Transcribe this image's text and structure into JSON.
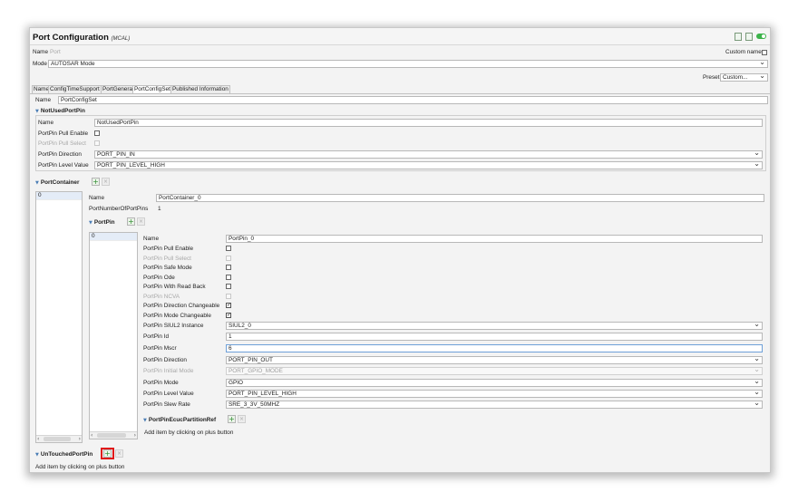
{
  "header": {
    "title": "Port Configuration",
    "subtitle": "(MCAL)",
    "name_label": "Name",
    "name_value": "Port",
    "custom_name_label": "Custom name",
    "mode_label": "Mode",
    "mode_value": "AUTOSAR Mode",
    "preset_label": "Preset",
    "preset_value": "Custom..."
  },
  "tabs": [
    {
      "label": "Name",
      "active": false
    },
    {
      "label": "ConfigTimeSupport",
      "active": false
    },
    {
      "label": "PortGeneral",
      "active": false
    },
    {
      "label": "PortConfigSet",
      "active": true
    },
    {
      "label": "Published Information",
      "active": false
    }
  ],
  "config_set": {
    "name_label": "Name",
    "name_value": "PortConfigSet"
  },
  "not_used_pin": {
    "header": "NotUsedPortPin",
    "name_label": "Name",
    "name_value": "NotUsedPortPin",
    "pull_enable_label": "PortPin Pull Enable",
    "pull_select_label": "PortPin Pull Select",
    "direction_label": "PortPin Direction",
    "direction_value": "PORT_PIN_IN",
    "level_label": "PortPin Level Value",
    "level_value": "PORT_PIN_LEVEL_HIGH"
  },
  "port_container": {
    "header": "PortContainer",
    "list_items": [
      "0"
    ],
    "name_label": "Name",
    "name_value": "PortContainer_0",
    "num_pins_label": "PortNumberOfPortPins",
    "num_pins_value": "1"
  },
  "port_pin": {
    "header": "PortPin",
    "list_items": [
      "0"
    ],
    "name_label": "Name",
    "name_value": "PortPin_0",
    "pull_enable_label": "PortPin Pull Enable",
    "pull_select_label": "PortPin Pull Select",
    "safe_mode_label": "PortPin Safe Mode",
    "ode_label": "PortPin Ode",
    "read_back_label": "PortPin With Read Back",
    "ncva_label": "PortPin NCVA",
    "dir_changeable_label": "PortPin Direction Changeable",
    "mode_changeable_label": "PortPin Mode Changeable",
    "siul2_label": "PortPin SIUL2 Instance",
    "siul2_value": "SIUL2_0",
    "id_label": "PortPin Id",
    "id_value": "1",
    "mscr_label": "PortPin Mscr",
    "mscr_value": "6",
    "direction_label": "PortPin Direction",
    "direction_value": "PORT_PIN_OUT",
    "initial_mode_label": "PortPin Initial Mode",
    "initial_mode_value": "PORT_GPIO_MODE",
    "mode_label": "PortPin Mode",
    "mode_value": "GPIO",
    "level_label": "PortPin Level Value",
    "level_value": "PORT_PIN_LEVEL_HIGH",
    "slew_label": "PortPin Slew Rate",
    "slew_value": "SRE_3_3V_50MHZ",
    "ecuc_header": "PortPinEcucPartitionRef",
    "add_hint": "Add item by clicking on plus button"
  },
  "untouched_pin": {
    "header": "UnTouchedPortPin",
    "add_hint": "Add item by clicking on plus button"
  },
  "glyphs": {
    "plus": "+",
    "close": "×",
    "caret": "▼",
    "left": "‹",
    "right": "›"
  }
}
